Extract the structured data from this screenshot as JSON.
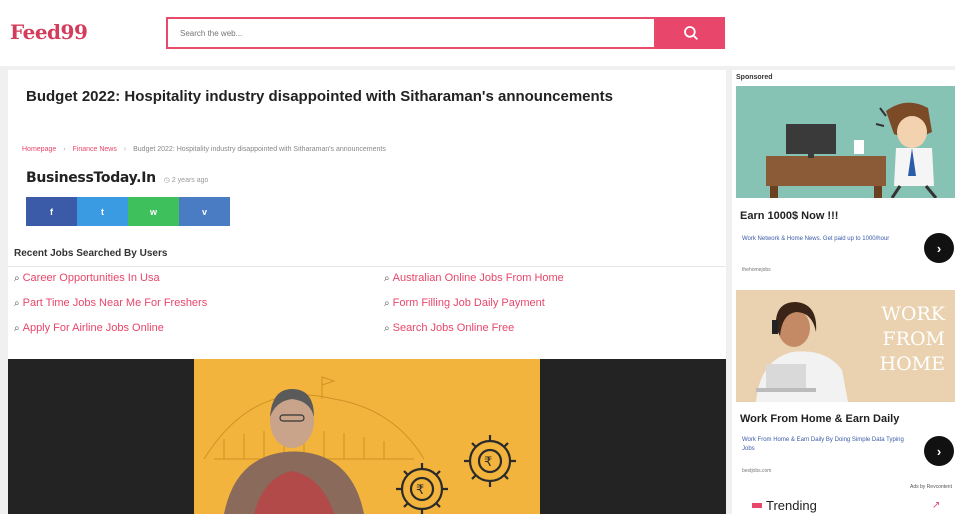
{
  "header": {
    "logo": "Feed99",
    "search_placeholder": "Search the web..."
  },
  "article": {
    "headline": "Budget 2022: Hospitality industry disappointed with Sitharaman's announcements",
    "breadcrumb": [
      "Homepage",
      "Finance News",
      "Budget 2022: Hospitality industry disappointed with Sitharaman's announcements"
    ],
    "source": "BusinessToday.In",
    "time": "2 years ago"
  },
  "share": {
    "facebook": "f",
    "twitter": "t",
    "whatsapp": "w",
    "more": "v"
  },
  "recent_jobs": {
    "title": "Recent Jobs Searched By Users",
    "items": [
      "Career Opportunities In Usa",
      "Australian Online Jobs From Home",
      "Part Time Jobs Near Me For Freshers",
      "Form Filling Job Daily Payment",
      "Apply For Airline Jobs Online",
      "Search Jobs Online Free"
    ]
  },
  "sidebar": {
    "sponsored": "Sponsored",
    "ad1": {
      "title": "Earn 1000$ Now !!!",
      "subtitle": "Work Network & Home News. Get paid up to 1000/hour",
      "domain": "thehomejobs"
    },
    "ad2": {
      "image_text": [
        "WORK",
        "FROM",
        "HOME"
      ],
      "title": "Work From Home & Earn Daily",
      "subtitle": "Work From Home & Earn Daily By Doing Simple Data Typing Jobs",
      "domain": "bestjobs.com"
    },
    "ads_by": "Ads by Revcontent",
    "trending": "Trending"
  },
  "colors": {
    "accent": "#e8466a",
    "facebook": "#3b5ba8",
    "twitter": "#3a9be2",
    "whatsapp": "#3ec15c"
  }
}
